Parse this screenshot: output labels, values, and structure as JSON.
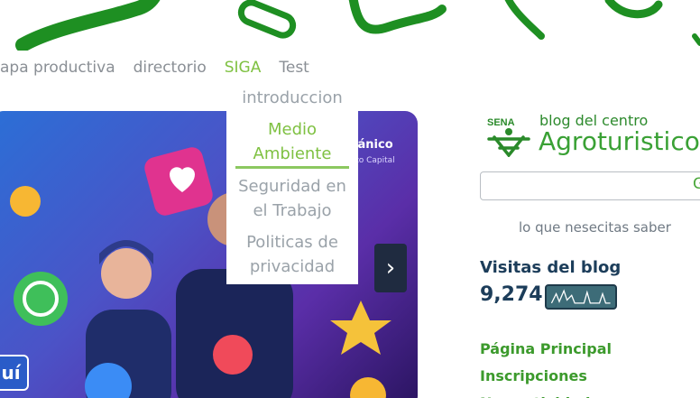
{
  "nav": {
    "items": [
      "apa productiva",
      "directorio",
      "SIGA",
      "Test"
    ],
    "active": "SIGA"
  },
  "dropdown": {
    "items": [
      "introduccion",
      "Medio Ambiente",
      "Seguridad en el Trabajo",
      "Politicas de privacidad"
    ],
    "selected": "Medio Ambiente"
  },
  "hero": {
    "badge": "ecánico",
    "badge_sub": "rito Capital",
    "next_glyph": "›",
    "cta_label": "uí"
  },
  "sidebar": {
    "brand_mark": "SENA",
    "blog_sub": "blog del centro",
    "blog_title": "Agroturistico",
    "search_glyph": "G",
    "tagline": "lo que nesecitas saber",
    "visits_title": "Visitas del blog",
    "visits_count": "9,274",
    "links": [
      "Página Principal",
      "Inscripciones",
      "Normatividad"
    ]
  },
  "colors": {
    "accent_green": "#7fc142",
    "link_green": "#3c9a2c",
    "title_navy": "#1c3d5a"
  }
}
